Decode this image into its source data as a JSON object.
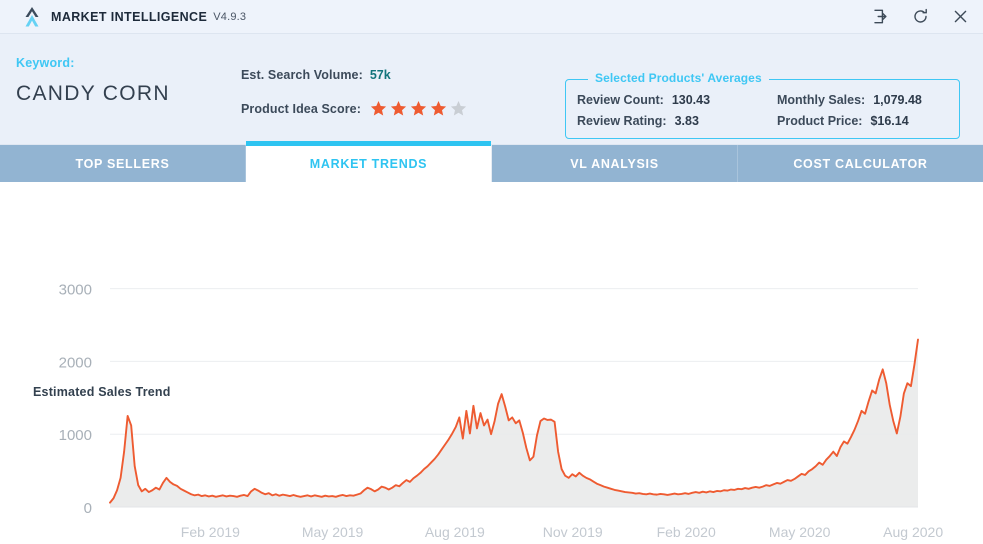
{
  "window": {
    "app_title": "MARKET INTELLIGENCE",
    "version": "V4.9.3",
    "controls": [
      {
        "name": "sign-in-icon",
        "label": "Sign in"
      },
      {
        "name": "refresh-icon",
        "label": "Refresh"
      },
      {
        "name": "close-icon",
        "label": "Close"
      }
    ]
  },
  "header": {
    "keyword_label": "Keyword:",
    "keyword_value": "CANDY CORN",
    "search_volume_label": "Est. Search Volume:",
    "search_volume_value": "57k",
    "idea_score_label": "Product Idea Score:",
    "idea_score_filled": 4,
    "idea_score_total": 5,
    "averages": {
      "legend": "Selected Products' Averages",
      "items": [
        {
          "label": "Review Count:",
          "value": "130.43"
        },
        {
          "label": "Monthly Sales:",
          "value": "1,079.48"
        },
        {
          "label": "Review Rating:",
          "value": "3.83"
        },
        {
          "label": "Product Price:",
          "value": "$16.14"
        }
      ]
    }
  },
  "tabs": [
    {
      "label": "TOP SELLERS",
      "active": false
    },
    {
      "label": "MARKET TRENDS",
      "active": true
    },
    {
      "label": "VL ANALYSIS",
      "active": false
    },
    {
      "label": "COST CALCULATOR",
      "active": false
    }
  ],
  "colors": {
    "accent_cyan": "#3fc7f4",
    "line_orange": "#ee5b31",
    "teal": "#12757c",
    "star_filled": "#ee5b31",
    "star_empty": "#c9ced4",
    "tab_inactive": "#92b4d2",
    "header_bg": "#eaf0f9"
  },
  "chart_data": {
    "type": "area",
    "title": "Estimated Sales Trend",
    "xlabel": "",
    "ylabel": "",
    "ylim": [
      0,
      3200
    ],
    "yticks": [
      0,
      1000,
      2000,
      3000
    ],
    "ytick_labels": [
      "0",
      "1000",
      "2000",
      "3000"
    ],
    "grid": true,
    "legend": "none",
    "xtick_labels": [
      "Feb 2019",
      "May 2019",
      "Aug 2019",
      "Nov 2019",
      "Feb 2020",
      "May 2020",
      "Aug 2020"
    ],
    "xtick_positions": [
      0.115,
      0.255,
      0.395,
      0.53,
      0.66,
      0.79,
      0.92
    ],
    "series": [
      {
        "name": "Estimated Sales",
        "color": "#ee5b31",
        "fill": "#e9eaea",
        "values": [
          60,
          120,
          230,
          400,
          760,
          1250,
          1120,
          560,
          300,
          215,
          250,
          205,
          230,
          265,
          240,
          330,
          400,
          345,
          310,
          290,
          250,
          225,
          200,
          175,
          160,
          170,
          150,
          160,
          145,
          155,
          140,
          150,
          160,
          145,
          155,
          150,
          140,
          155,
          165,
          150,
          215,
          250,
          225,
          195,
          175,
          190,
          160,
          175,
          155,
          170,
          160,
          150,
          165,
          150,
          140,
          150,
          160,
          145,
          160,
          150,
          140,
          155,
          145,
          150,
          140,
          155,
          165,
          150,
          160,
          155,
          170,
          185,
          230,
          265,
          245,
          215,
          240,
          280,
          265,
          240,
          265,
          300,
          285,
          330,
          370,
          345,
          395,
          430,
          470,
          520,
          560,
          610,
          660,
          720,
          790,
          860,
          930,
          1010,
          1100,
          1230,
          940,
          1320,
          1010,
          1390,
          1080,
          1290,
          1120,
          1200,
          1000,
          1180,
          1420,
          1550,
          1380,
          1190,
          1230,
          1150,
          1190,
          1020,
          810,
          640,
          690,
          980,
          1180,
          1215,
          1195,
          1200,
          1170,
          760,
          520,
          430,
          400,
          450,
          420,
          470,
          430,
          400,
          380,
          350,
          320,
          300,
          280,
          265,
          250,
          235,
          225,
          215,
          205,
          200,
          195,
          185,
          190,
          180,
          175,
          185,
          175,
          170,
          180,
          175,
          165,
          175,
          185,
          175,
          180,
          190,
          180,
          195,
          205,
          195,
          210,
          200,
          215,
          205,
          220,
          215,
          230,
          225,
          240,
          235,
          250,
          245,
          260,
          250,
          265,
          275,
          265,
          280,
          300,
          290,
          310,
          330,
          320,
          345,
          370,
          360,
          385,
          420,
          455,
          440,
          490,
          520,
          560,
          610,
          580,
          650,
          700,
          760,
          700,
          820,
          900,
          870,
          960,
          1060,
          1180,
          1320,
          1280,
          1450,
          1600,
          1560,
          1750,
          1890,
          1700,
          1400,
          1180,
          1010,
          1240,
          1560,
          1700,
          1660,
          1960,
          2300
        ]
      }
    ]
  }
}
